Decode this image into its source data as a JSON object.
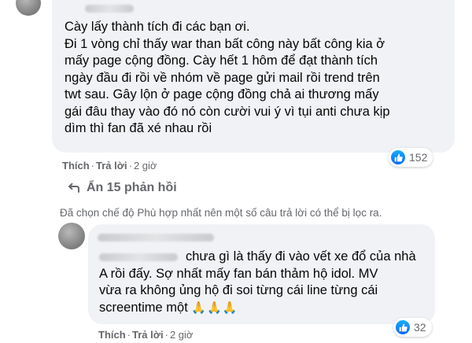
{
  "comments": [
    {
      "text_lines": [
        "Cày lấy thành tích đi các bạn ơi.",
        "Đi 1 vòng chỉ thấy war than bất công này bất công kia ở",
        "mấy page cộng đồng. Cày hết 1 hôm để đạt thành tích",
        "ngày đầu đi rồi về nhóm về page gửi mail rồi trend trên",
        "twt sau. Gây lộn ở page cộng đồng chả ai thương mấy",
        "gái đâu thay vào đó nó còn cười vui ý vì tụi anti chưa kịp",
        "dìm thì fan đã xé nhau rồi"
      ],
      "reaction_count": "152",
      "actions": {
        "like": "Thích",
        "reply": "Trả lời",
        "time": "2 giờ"
      }
    },
    {
      "text_lines": [
        "chưa gì là thấy đi vào vết xe đổ của nhà",
        "A rồi đấy. Sợ nhất mấy fan bán thảm hộ idol. MV",
        "vừa ra không ủng hộ đi soi từng cái line từng cái",
        "screentime một"
      ],
      "emoji": "🙏🙏🙏",
      "reaction_count": "32",
      "actions": {
        "like": "Thích",
        "reply": "Trả lời",
        "time": "2 giờ"
      }
    }
  ],
  "hidden_replies": {
    "label": "Ẩn 15 phản hồi"
  },
  "filter_notice": "Đã chọn chế độ Phù hợp nhất nên một số câu trả lời có thể bị lọc ra.",
  "colors": {
    "like_blue": "#0866ff",
    "bubble_bg": "#f0f2f5",
    "secondary_text": "#65676b"
  },
  "icons": {
    "reaction": "like-icon",
    "replies_toggle": "reply-arrow-icon"
  }
}
